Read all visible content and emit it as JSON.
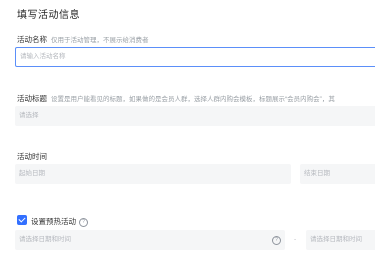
{
  "page": {
    "title": "填写活动信息"
  },
  "activity_name": {
    "label": "活动名称",
    "hint": "仅用于活动管理，不展示给消费者",
    "placeholder": "请输入活动名称"
  },
  "activity_subject": {
    "label": "活动标题",
    "hint": "设置是用户能看见的标题，如果做的是会员人群，选择人群内购会模板，标题展示“会员内购会”，其",
    "placeholder": "请选择"
  },
  "activity_time": {
    "label": "活动时间",
    "start_placeholder": "起始日期",
    "end_placeholder": "结束日期"
  },
  "warmup": {
    "checkbox_label": "设置预热活动",
    "checked": true,
    "start_placeholder": "请选择日期和时间",
    "separator": "-",
    "end_placeholder": "请选择日期和时间"
  },
  "colors": {
    "accent": "#3370ff",
    "focus_border": "#5b8ff9"
  },
  "icons": {
    "warmup_info": "info-icon",
    "start_time": "help-icon"
  }
}
